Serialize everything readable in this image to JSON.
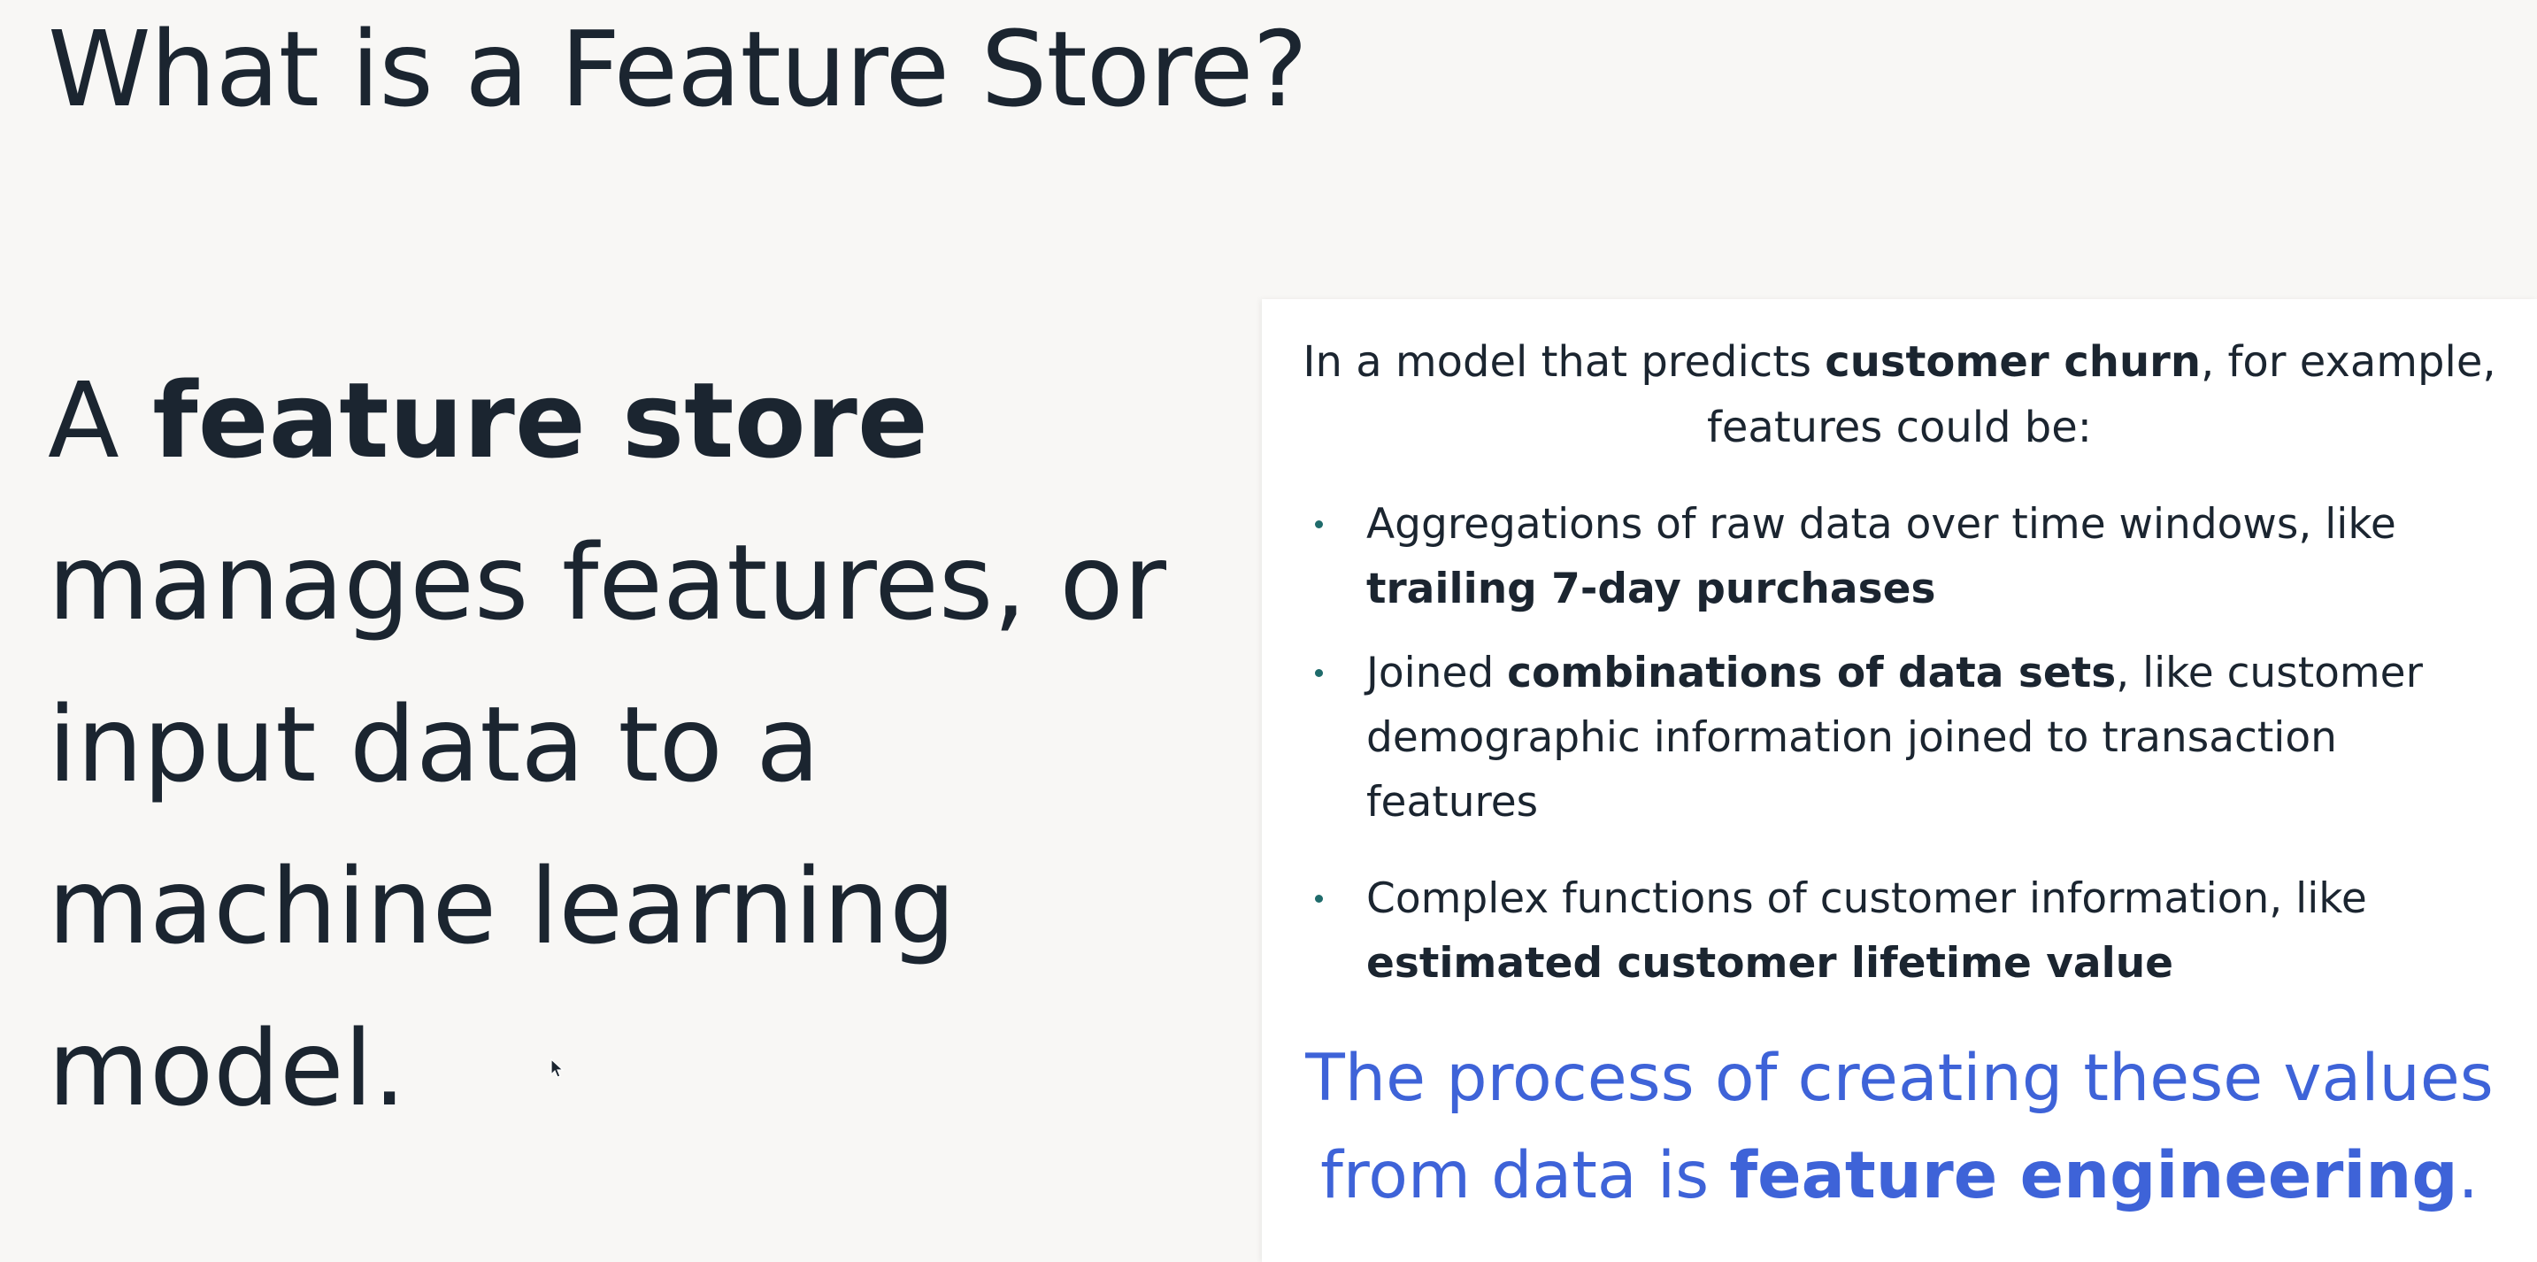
{
  "slide": {
    "title": "What is a Feature Store?"
  },
  "definition": {
    "lead": "A ",
    "term": "feature store",
    "rest": " manages features, or input data to a machine learning model."
  },
  "example_card": {
    "intro": {
      "before": "In a model that predicts ",
      "bold": "customer churn",
      "after": ", for example, features could be:"
    },
    "bullets": [
      {
        "before": "Aggregations of raw data over time windows, like ",
        "bold": "trailing 7-day purchases",
        "after": ""
      },
      {
        "before": "Joined ",
        "bold": "combinations of data sets",
        "after": ", like customer demographic information joined to transaction features"
      },
      {
        "before": "Complex functions of customer information, like ",
        "bold": "estimated customer lifetime value",
        "after": ""
      }
    ],
    "conclusion": {
      "before": "The process of creating these values from data is ",
      "bold": "feature engineering",
      "after": "."
    }
  },
  "colors": {
    "background": "#f8f7f5",
    "text": "#1b2530",
    "accent_blue": "#3e63d8",
    "bullet": "#1f6b6b",
    "card": "#ffffff"
  },
  "icons": {
    "cursor": "mouse-pointer-icon"
  }
}
